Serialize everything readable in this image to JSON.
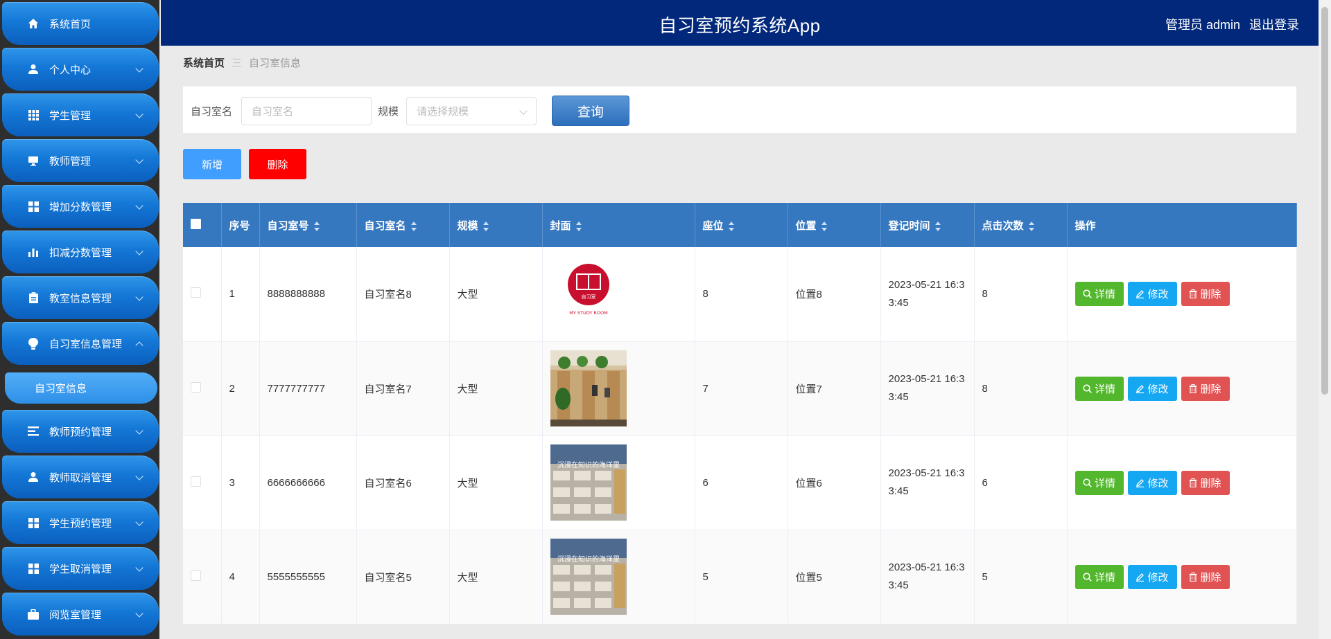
{
  "sidebar": {
    "items": [
      {
        "label": "系统首页",
        "icon": "home-icon"
      },
      {
        "label": "个人中心",
        "icon": "user-icon"
      },
      {
        "label": "学生管理",
        "icon": "grid-icon"
      },
      {
        "label": "教师管理",
        "icon": "monitor-icon"
      },
      {
        "label": "增加分数管理",
        "icon": "apps-icon"
      },
      {
        "label": "扣减分数管理",
        "icon": "bar-chart-icon"
      },
      {
        "label": "教室信息管理",
        "icon": "clipboard-icon"
      },
      {
        "label": "自习室信息管理",
        "icon": "bulb-icon"
      },
      {
        "label": "教师预约管理",
        "icon": "list-icon"
      },
      {
        "label": "教师取消管理",
        "icon": "user-icon"
      },
      {
        "label": "学生预约管理",
        "icon": "apps-icon"
      },
      {
        "label": "学生取消管理",
        "icon": "apps-icon"
      },
      {
        "label": "阅览室管理",
        "icon": "briefcase-icon"
      }
    ],
    "sub_item": "自习室信息"
  },
  "header": {
    "title": "自习室预约系统App",
    "user": "管理员 admin",
    "logout": "退出登录"
  },
  "breadcrumb": {
    "home": "系统首页",
    "separator": "三",
    "current": "自习室信息"
  },
  "search": {
    "name_label": "自习室名",
    "name_placeholder": "自习室名",
    "scale_label": "规模",
    "scale_placeholder": "请选择规模",
    "query": "查询"
  },
  "actions": {
    "add": "新增",
    "delete": "删除"
  },
  "table": {
    "headers": [
      "序号",
      "自习室号",
      "自习室名",
      "规模",
      "封面",
      "座位",
      "位置",
      "登记时间",
      "点击次数",
      "操作"
    ],
    "buttons": {
      "detail": "详情",
      "edit": "修改",
      "delete": "删除"
    },
    "rows": [
      {
        "no": "1",
        "room_no": "8888888888",
        "name": "自习室名8",
        "scale": "大型",
        "cover": "logo",
        "seats": "8",
        "location": "位置8",
        "time": "2023-05-21 16:33:45",
        "clicks": "8"
      },
      {
        "no": "2",
        "room_no": "7777777777",
        "name": "自习室名7",
        "scale": "大型",
        "cover": "photo-plants",
        "seats": "7",
        "location": "位置7",
        "time": "2023-05-21 16:33:45",
        "clicks": "8"
      },
      {
        "no": "3",
        "room_no": "6666666666",
        "name": "自习室名6",
        "scale": "大型",
        "cover": "photo-room",
        "seats": "6",
        "location": "位置6",
        "time": "2023-05-21 16:33:45",
        "clicks": "6"
      },
      {
        "no": "4",
        "room_no": "5555555555",
        "name": "自习室名5",
        "scale": "大型",
        "cover": "photo-room",
        "seats": "5",
        "location": "位置5",
        "time": "2023-05-21 16:33:45",
        "clicks": "5"
      }
    ]
  },
  "cover_images": {
    "logo_text": "MY STUDY ROOM",
    "logo_sub": "自习室",
    "photo_caption": "沉浸在知识的海洋里"
  },
  "colors": {
    "header_bg": "#02287c",
    "table_header_bg": "#3578c0",
    "detail_btn": "#52b72c",
    "edit_btn": "#16a7f3",
    "delete_btn": "#e15252",
    "add_btn": "#409eff",
    "batch_delete_btn": "#ff0000"
  }
}
